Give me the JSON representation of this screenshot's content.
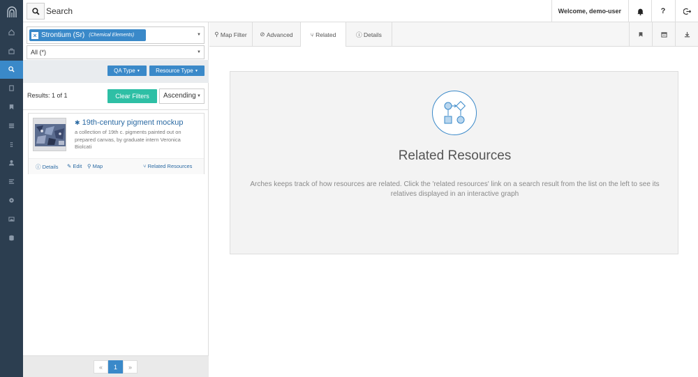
{
  "search": {
    "label": "Search"
  },
  "header": {
    "welcome": "Welcome, demo-user",
    "help": "?"
  },
  "filter": {
    "term_name": "Strontium (Sr)",
    "term_category": "(Chemical Elements)",
    "all_value": "All (*)",
    "qa_type": "QA Type",
    "resource_type": "Resource Type"
  },
  "results": {
    "count_label": "Results: 1 of 1",
    "clear_filters": "Clear Filters",
    "sort": "Ascending"
  },
  "result_card": {
    "title": "19th-century pigment mockup",
    "description": "a collection of 19th c. pigments painted out on prepared canvas, by graduate intern Veronica Biolcati",
    "links": {
      "details": "Details",
      "edit": "Edit",
      "map": "Map",
      "related": "Related Resources"
    }
  },
  "pager": {
    "prev": "«",
    "current": "1",
    "next": "»"
  },
  "tabs": {
    "map_filter": "Map Filter",
    "advanced": "Advanced",
    "related": "Related",
    "details": "Details"
  },
  "related_panel": {
    "title": "Related Resources",
    "description": "Arches keeps track of how resources are related. Click the 'related resources' link on a search result from the list on the left to see its relatives displayed in an interactive graph"
  },
  "colors": {
    "nav_bg": "#2c3e50",
    "accent": "#3a89c9",
    "teal": "#2ebfa5"
  }
}
